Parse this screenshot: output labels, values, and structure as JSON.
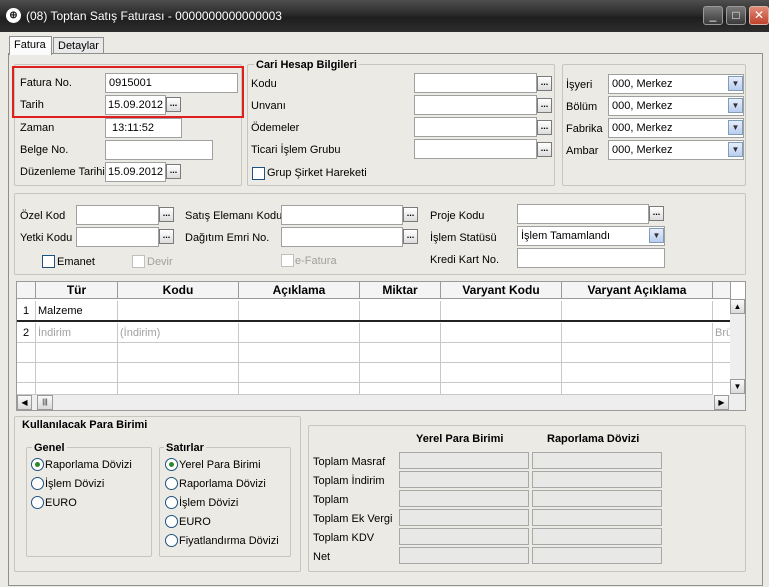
{
  "window": {
    "title": "(08) Toptan Satış Faturası - 0000000000000003",
    "minimize": "_",
    "maximize": "□",
    "close": "✕"
  },
  "tabs": [
    {
      "label": "Fatura",
      "active": true
    },
    {
      "label": "Detaylar",
      "active": false
    }
  ],
  "header": {
    "fatura_no_label": "Fatura No.",
    "fatura_no_value": "0915001",
    "tarih_label": "Tarih",
    "tarih_value": "15.09.2012",
    "zaman_label": "Zaman",
    "zaman_value": "13:11:52",
    "belge_no_label": "Belge No.",
    "belge_no_value": "",
    "duzenleme_label": "Düzenleme Tarihi",
    "duzenleme_value": "15.09.2012"
  },
  "cari": {
    "title": "Cari Hesap Bilgileri",
    "kodu_label": "Kodu",
    "unvani_label": "Unvanı",
    "odemeler_label": "Ödemeler",
    "ticari_label": "Ticari İşlem Grubu",
    "grup_label": "Grup Şirket Hareketi"
  },
  "org": {
    "isyeri_label": "İşyeri",
    "isyeri_value": "000, Merkez",
    "bolum_label": "Bölüm",
    "bolum_value": "000, Merkez",
    "fabrika_label": "Fabrika",
    "fabrika_value": "000, Merkez",
    "ambar_label": "Ambar",
    "ambar_value": "000, Merkez"
  },
  "mid": {
    "ozel_kod_label": "Özel Kod",
    "yetki_kodu_label": "Yetki Kodu",
    "satis_elemani_label": "Satış Elemanı Kodu",
    "dagitim_label": "Dağıtım Emri No.",
    "proje_label": "Proje Kodu",
    "islem_statusu_label": "İşlem Statüsü",
    "islem_statusu_value": "İşlem Tamamlandı",
    "kredi_kart_label": "Kredi Kart No.",
    "emanet_label": "Emanet",
    "devir_label": "Devir",
    "efatura_label": "e-Fatura"
  },
  "grid": {
    "columns": [
      "Tür",
      "Kodu",
      "Açıklama",
      "Miktar",
      "Varyant Kodu",
      "Varyant Açıklama"
    ],
    "rows": [
      {
        "num": "1",
        "tur": "Malzeme",
        "kodu": "",
        "aciklama": "",
        "tail": ""
      },
      {
        "num": "2",
        "tur": "İndirim",
        "kodu": "(İndirim)",
        "aciklama": "",
        "tail": "Brü"
      }
    ],
    "scroll_up": "▲",
    "scroll_down": "▼",
    "scroll_left": "◀",
    "scroll_right": "▶",
    "thumb": "|||"
  },
  "currency": {
    "title": "Kullanılacak Para Birimi",
    "genel_title": "Genel",
    "genel_options": [
      {
        "label": "Raporlama Dövizi",
        "selected": true
      },
      {
        "label": "İşlem Dövizi",
        "selected": false
      },
      {
        "label": "EURO",
        "selected": false
      }
    ],
    "satirlar_title": "Satırlar",
    "satirlar_options": [
      {
        "label": "Yerel Para Birimi",
        "selected": true
      },
      {
        "label": "Raporlama Dövizi",
        "selected": false
      },
      {
        "label": "İşlem Dövizi",
        "selected": false
      },
      {
        "label": "EURO",
        "selected": false
      },
      {
        "label": "Fiyatlandırma Dövizi",
        "selected": false
      }
    ]
  },
  "totals": {
    "col_local": "Yerel Para Birimi",
    "col_report": "Raporlama Dövizi",
    "rows": [
      "Toplam Masraf",
      "Toplam İndirim",
      "Toplam",
      "Toplam Ek Vergi",
      "Toplam KDV",
      "Net"
    ]
  },
  "ellipsis": "...",
  "dropdown_glyph": "▼"
}
